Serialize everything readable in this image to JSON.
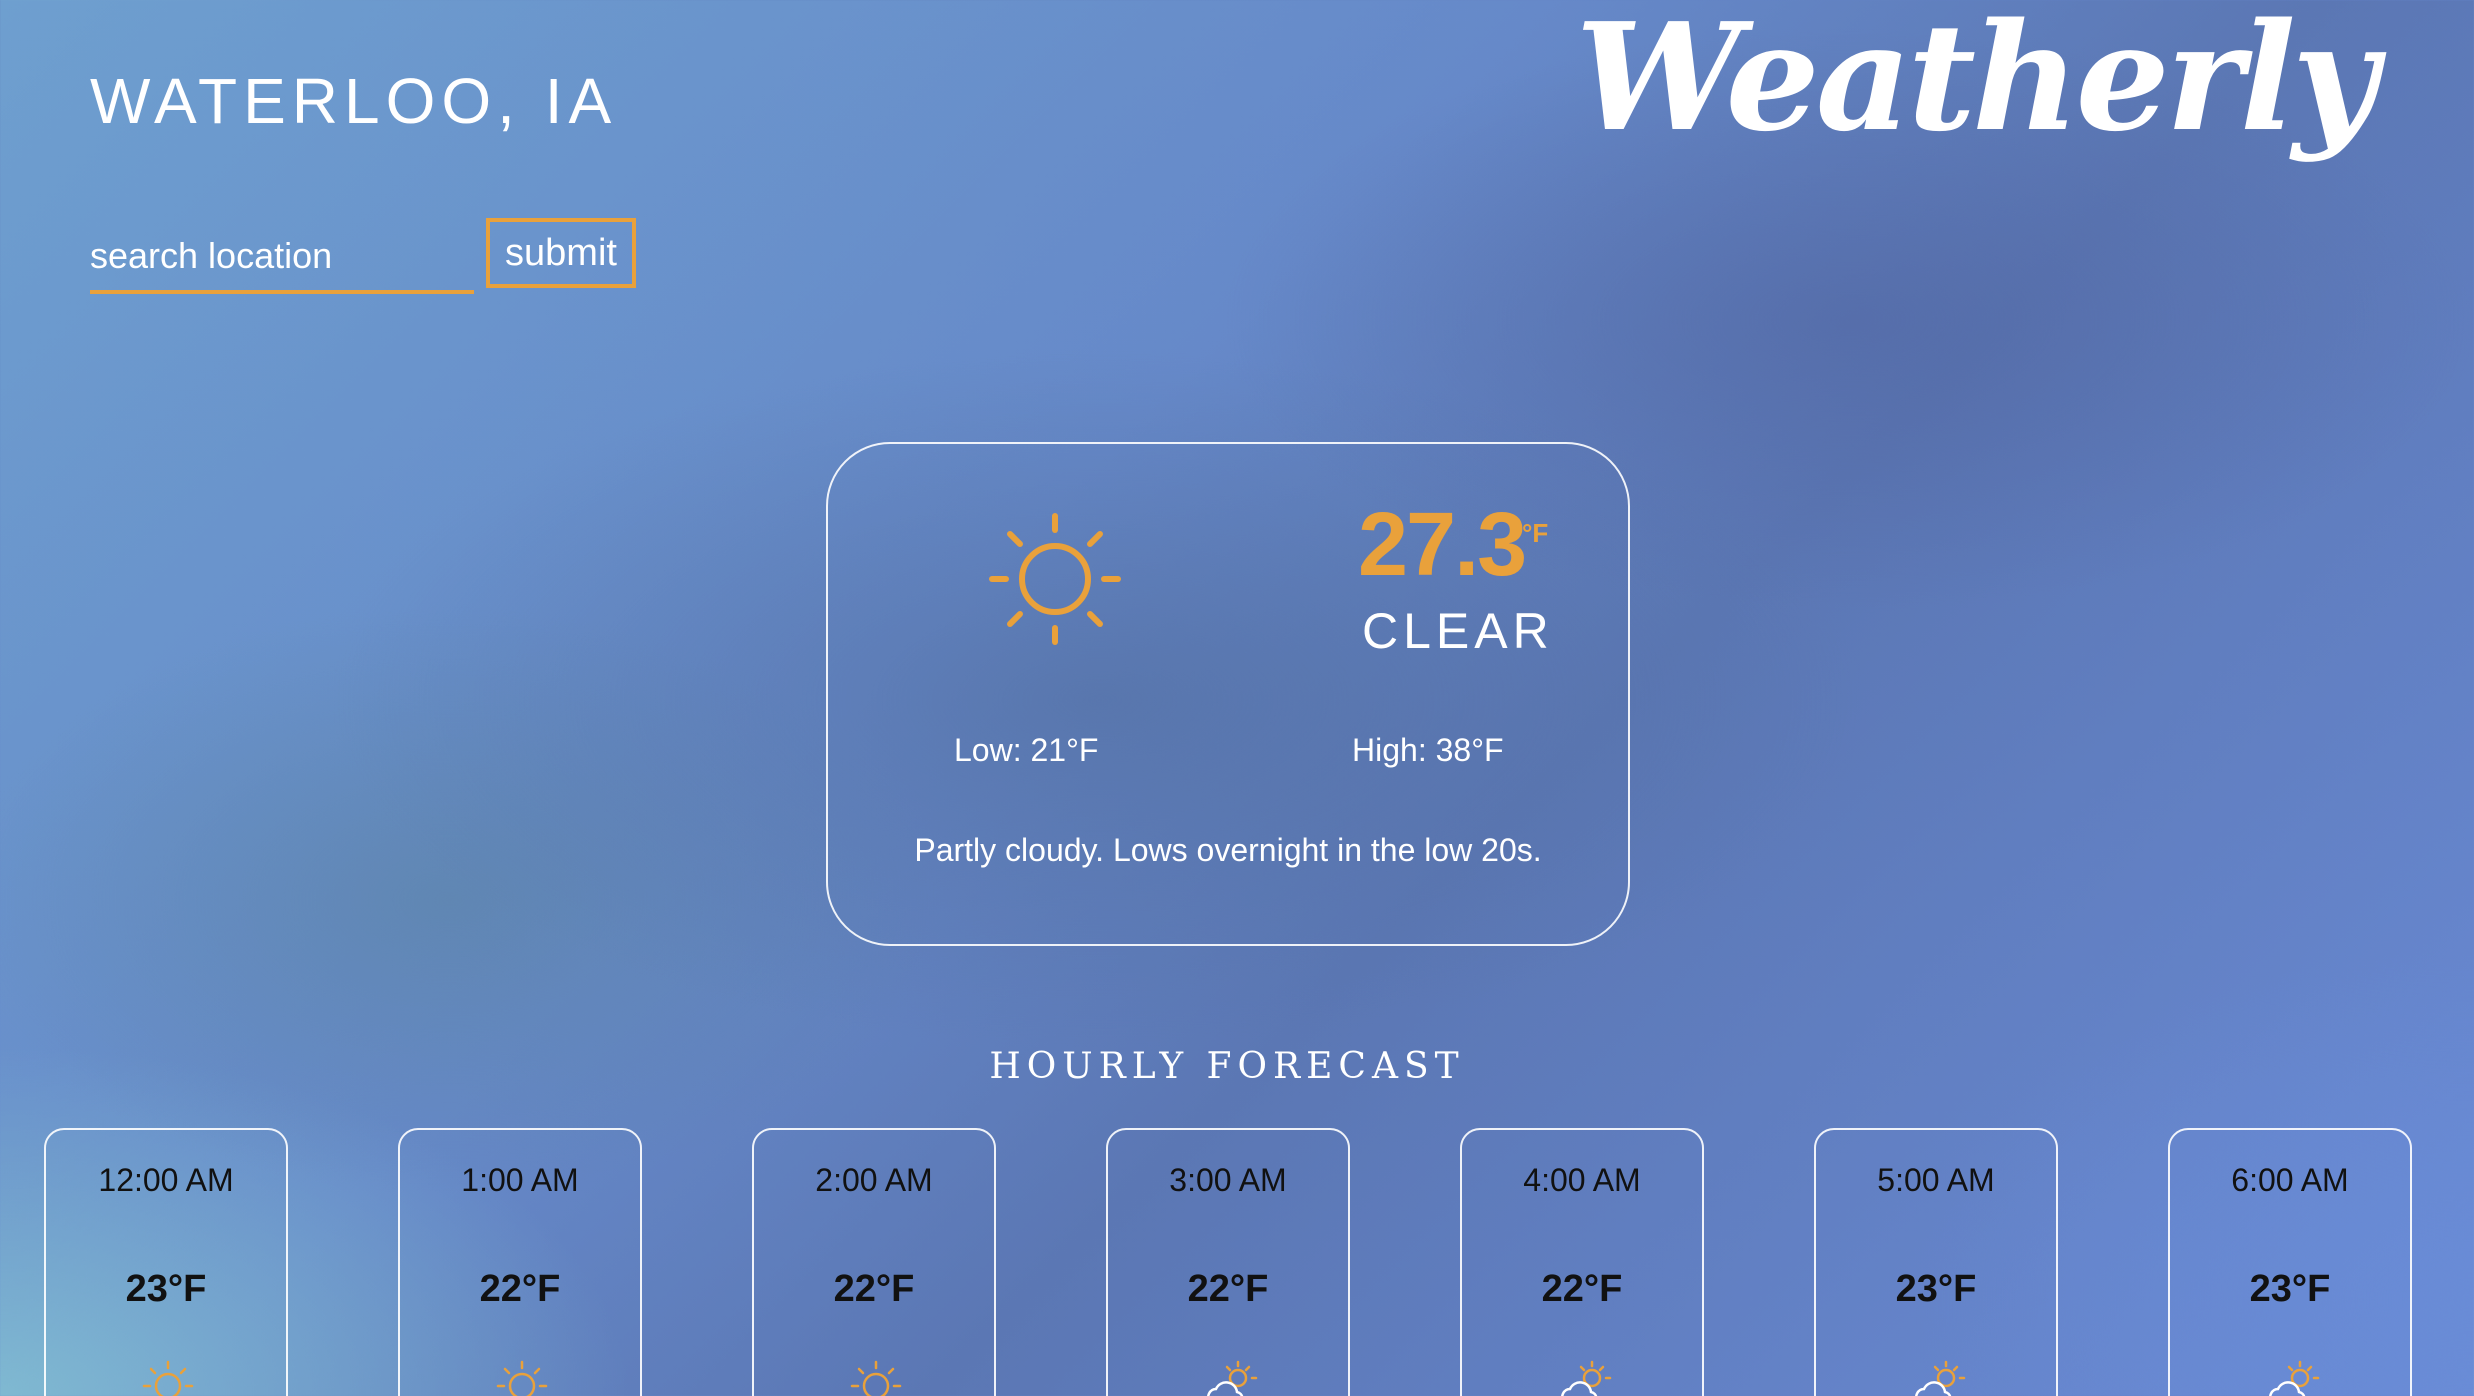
{
  "header": {
    "location": "WATERLOO, IA",
    "logo": "Weatherly"
  },
  "search": {
    "placeholder": "search location",
    "submit_label": "submit"
  },
  "current": {
    "icon": "sun-icon",
    "temperature": "27.3",
    "unit": "°F",
    "condition": "CLEAR",
    "low": "Low: 21°F",
    "high": "High: 38°F",
    "summary": "Partly cloudy. Lows overnight in the low 20s."
  },
  "hourly": {
    "title": "HOURLY FORECAST",
    "items": [
      {
        "time": "12:00 AM",
        "temp": "23°F",
        "icon": "sun-icon"
      },
      {
        "time": "1:00 AM",
        "temp": "22°F",
        "icon": "sun-icon"
      },
      {
        "time": "2:00 AM",
        "temp": "22°F",
        "icon": "sun-icon"
      },
      {
        "time": "3:00 AM",
        "temp": "22°F",
        "icon": "partly-cloudy-icon"
      },
      {
        "time": "4:00 AM",
        "temp": "22°F",
        "icon": "partly-cloudy-icon"
      },
      {
        "time": "5:00 AM",
        "temp": "23°F",
        "icon": "partly-cloudy-icon"
      },
      {
        "time": "6:00 AM",
        "temp": "23°F",
        "icon": "partly-cloudy-icon"
      }
    ]
  },
  "colors": {
    "accent": "#e9a13b",
    "text": "#ffffff",
    "hourly_text": "#111111"
  }
}
